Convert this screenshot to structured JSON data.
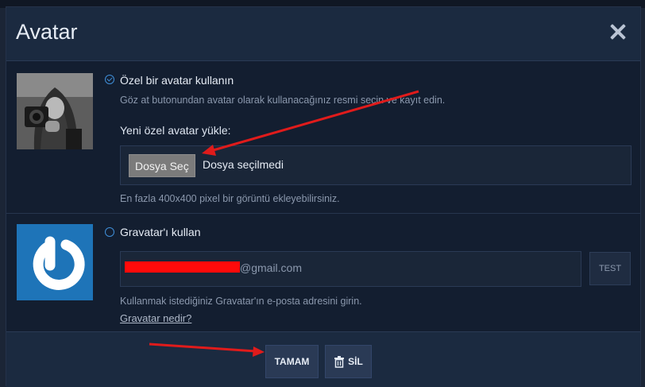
{
  "dialog": {
    "title": "Avatar",
    "close_icon": "close-icon"
  },
  "custom": {
    "option_label": "Özel bir avatar kullanın",
    "description": "Göz at butonundan avatar olarak kullanacağınız resmi seçin ve kayıt edin.",
    "upload_label": "Yeni özel avatar yükle:",
    "choose_file_button": "Dosya Seç",
    "file_status": "Dosya seçilmedi",
    "size_hint": "En fazla 400x400 pixel bir görüntü ekleyebilirsiniz.",
    "selected": true
  },
  "gravatar": {
    "option_label": "Gravatar'ı kullan",
    "email_value": "@gmail.com",
    "test_button": "TEST",
    "hint": "Kullanmak istediğiniz Gravatar'ın e-posta adresini girin.",
    "link": "Gravatar nedir?",
    "selected": false
  },
  "footer": {
    "ok_button": "TAMAM",
    "delete_button": "SİL",
    "delete_icon": "trash-icon"
  },
  "colors": {
    "accent": "#3f8fd9",
    "annotation_arrow": "#e01b1b",
    "redaction": "#ff0a0a",
    "gravatar_blue": "#1e74b8"
  }
}
